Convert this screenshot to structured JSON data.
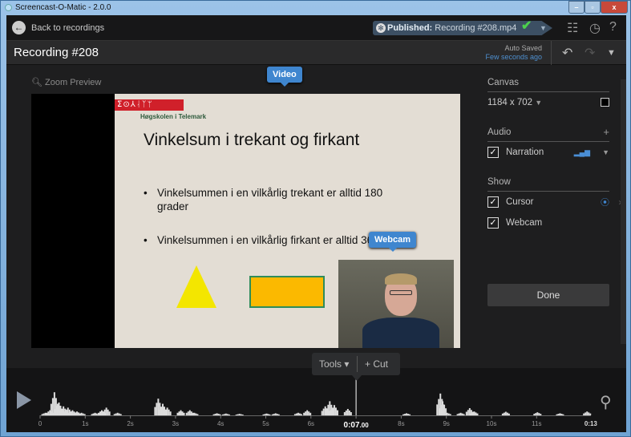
{
  "window": {
    "title": "Screencast-O-Matic - 2.0.0",
    "controls": [
      "minimize",
      "maximize",
      "close"
    ]
  },
  "topbar": {
    "back_label": "Back to recordings",
    "published_label": "Published:",
    "published_file": "Recording #208.mp4",
    "status_color": "#4cd04c",
    "icons": [
      "publish-list-icon",
      "history-icon",
      "help-icon"
    ],
    "help": "?"
  },
  "recording": {
    "title": "Recording #208",
    "auto_saved": "Auto Saved",
    "saved_time": "Few seconds ago"
  },
  "preview": {
    "zoom_label": "Zoom Preview",
    "video_tooltip": "Video",
    "webcam_tooltip": "Webcam"
  },
  "slide": {
    "logo_text": "ⴶ⊙⅄ᛆᛉᛘ",
    "school": "Høgskolen i Telemark",
    "title": "Vinkelsum i trekant og firkant",
    "bullets": [
      "Vinkelsummen i en vilkårlig trekant er alltid 180 grader",
      "Vinkelsummen i en vilkårlig firkant er alltid 360 grader"
    ]
  },
  "panel": {
    "canvas_label": "Canvas",
    "canvas_size": "1184 x 702",
    "audio_label": "Audio",
    "audio_add": "+",
    "narration": "Narration",
    "narration_checked": true,
    "show_label": "Show",
    "cursor": "Cursor",
    "cursor_checked": true,
    "webcam": "Webcam",
    "webcam_checked": true,
    "done": "Done"
  },
  "timeline": {
    "tools_label": "Tools",
    "cut_label": "Cut",
    "current_time": "0:07",
    "current_frac": ".00",
    "end_label": "0:13",
    "tick_labels": [
      "0",
      "1s",
      "2s",
      "3s",
      "4s",
      "5s",
      "6s",
      "",
      "8s",
      "9s",
      "10s",
      "11s"
    ],
    "playhead_seconds": 7,
    "waveform": [
      [
        0.1,
        0.1
      ],
      [
        0.2,
        0.2
      ],
      [
        0.3,
        0.9
      ],
      [
        0.4,
        0.5
      ],
      [
        0.5,
        0.35
      ],
      [
        0.6,
        0.3
      ],
      [
        0.7,
        0.2
      ],
      [
        0.8,
        0.15
      ],
      [
        0.9,
        0.1
      ],
      [
        1.2,
        0.1
      ],
      [
        1.35,
        0.2
      ],
      [
        1.45,
        0.3
      ],
      [
        1.7,
        0.1
      ],
      [
        2.6,
        0.65
      ],
      [
        2.7,
        0.45
      ],
      [
        2.8,
        0.3
      ],
      [
        3.1,
        0.2
      ],
      [
        3.3,
        0.2
      ],
      [
        3.4,
        0.1
      ],
      [
        3.9,
        0.08
      ],
      [
        4.1,
        0.07
      ],
      [
        4.4,
        0.06
      ],
      [
        5.0,
        0.07
      ],
      [
        5.2,
        0.08
      ],
      [
        5.7,
        0.1
      ],
      [
        5.9,
        0.2
      ],
      [
        6.3,
        0.35
      ],
      [
        6.4,
        0.55
      ],
      [
        6.5,
        0.4
      ],
      [
        6.8,
        0.25
      ],
      [
        8.1,
        0.08
      ],
      [
        8.85,
        0.85
      ],
      [
        8.9,
        0.55
      ],
      [
        9.0,
        0.1
      ],
      [
        9.3,
        0.1
      ],
      [
        9.5,
        0.28
      ],
      [
        9.6,
        0.15
      ],
      [
        10.3,
        0.14
      ],
      [
        11.0,
        0.12
      ],
      [
        11.5,
        0.08
      ],
      [
        12.1,
        0.15
      ]
    ]
  }
}
